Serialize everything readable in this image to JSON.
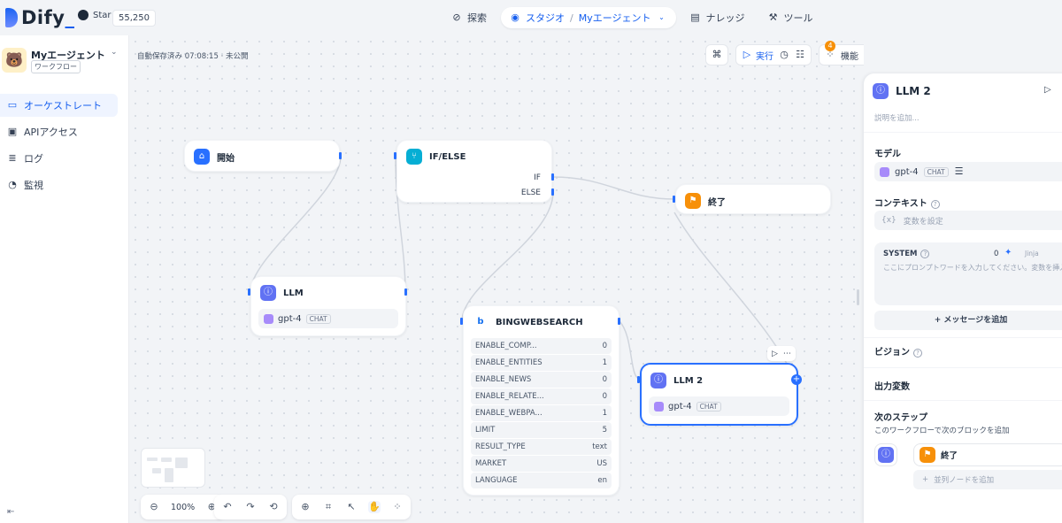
{
  "brand": {
    "name": "Dify",
    "suffix": "_"
  },
  "github": {
    "label": "Star",
    "count": "55,250"
  },
  "nav": {
    "explore": "探索",
    "studio": "スタジオ",
    "sep": "/",
    "app_crumb": "Myエージェント",
    "knowledge": "ナレッジ",
    "tools": "ツール"
  },
  "app": {
    "name": "Myエージェント",
    "type": "ワークフロー"
  },
  "sidebar": {
    "items": [
      {
        "label": "オーケストレート"
      },
      {
        "label": "APIアクセス"
      },
      {
        "label": "ログ"
      },
      {
        "label": "監視"
      }
    ]
  },
  "canvas": {
    "autosave": "自動保存済み 07:08:15 · 未公開",
    "run_label": "実行",
    "features_label": "機能",
    "checklist_count": "4"
  },
  "nodes": {
    "start": {
      "title": "開始"
    },
    "ifelse": {
      "title": "IF/ELSE",
      "if_label": "IF",
      "else_label": "ELSE"
    },
    "end": {
      "title": "終了"
    },
    "llm": {
      "title": "LLM",
      "model": "gpt-4",
      "mode": "CHAT"
    },
    "bing": {
      "title": "BINGWEBSEARCH",
      "params": [
        {
          "key": "ENABLE_COMP...",
          "value": "0"
        },
        {
          "key": "ENABLE_ENTITIES",
          "value": "1"
        },
        {
          "key": "ENABLE_NEWS",
          "value": "0"
        },
        {
          "key": "ENABLE_RELATE...",
          "value": "0"
        },
        {
          "key": "ENABLE_WEBPA...",
          "value": "1"
        },
        {
          "key": "LIMIT",
          "value": "5"
        },
        {
          "key": "RESULT_TYPE",
          "value": "text"
        },
        {
          "key": "MARKET",
          "value": "US"
        },
        {
          "key": "LANGUAGE",
          "value": "en"
        }
      ]
    },
    "llm2": {
      "title": "LLM 2",
      "model": "gpt-4",
      "mode": "CHAT"
    }
  },
  "zoom": "100%",
  "panel": {
    "title": "LLM 2",
    "description_placeholder": "説明を追加...",
    "model_label": "モデル",
    "model": "gpt-4",
    "model_mode": "CHAT",
    "context_label": "コンテキスト",
    "context_placeholder": "変数を設定",
    "system_label": "SYSTEM",
    "system_count": "0",
    "jinja_label": "Jinja",
    "system_placeholder": "ここにプロンプトワードを入力してください。変数を挿入す...",
    "add_message": "+ メッセージを追加",
    "vision_label": "ビジョン",
    "output_label": "出力変数",
    "next_step_label": "次のステップ",
    "next_step_sub": "このワークフローで次のブロックを追加",
    "next_target": "終了",
    "parallel_placeholder": "並列ノードを追加"
  },
  "colors": {
    "accent": "#155eef",
    "llm_icon": "#6172f3",
    "ifelse_icon": "#06aed4",
    "end_icon": "#f79009"
  }
}
